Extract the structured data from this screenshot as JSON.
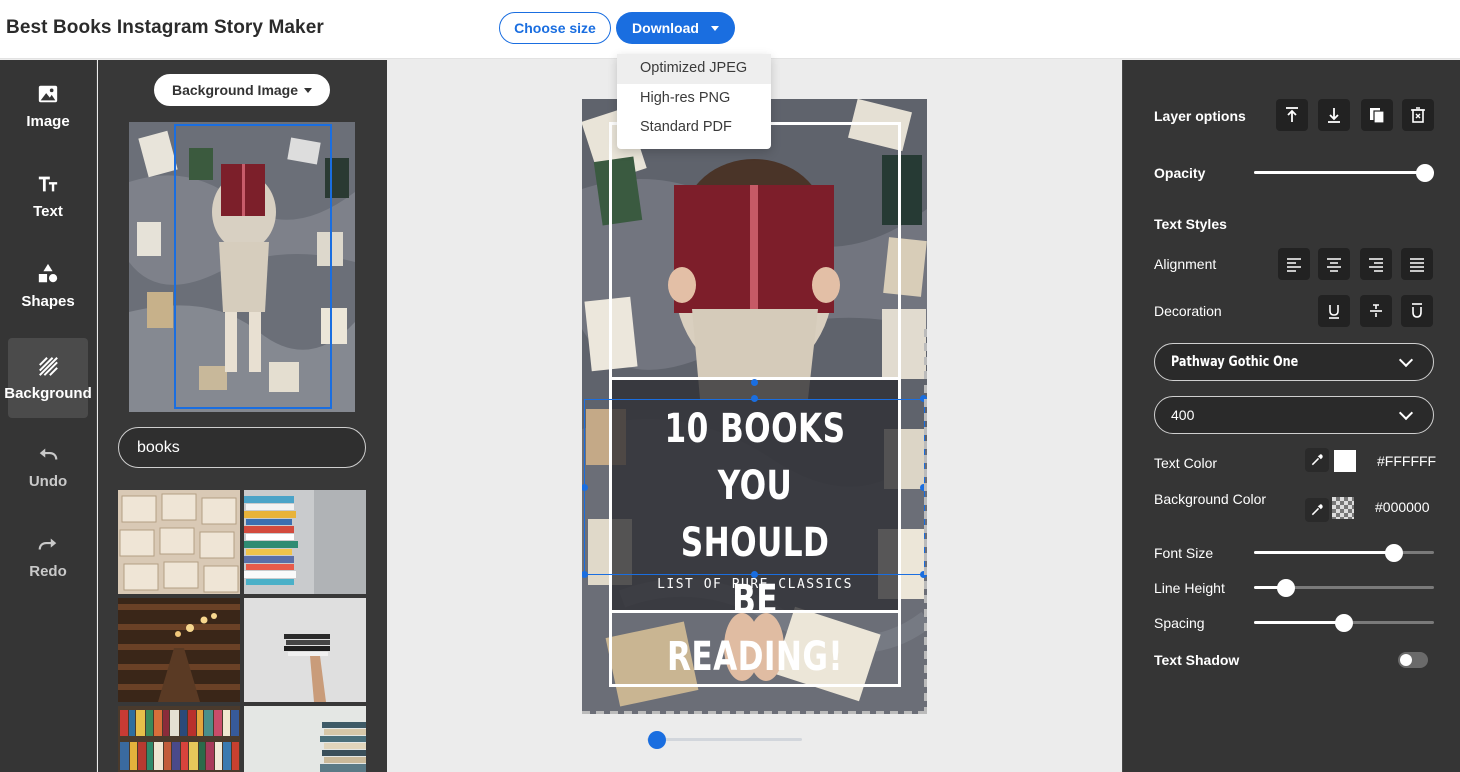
{
  "header": {
    "title": "Best Books Instagram Story Maker",
    "choose_size": "Choose size",
    "download": "Download"
  },
  "download_menu": {
    "items": [
      "Optimized JPEG",
      "High-res PNG",
      "Standard PDF"
    ],
    "highlighted": "Optimized JPEG"
  },
  "rail": {
    "items": [
      {
        "label": "Image",
        "icon": "image-icon"
      },
      {
        "label": "Text",
        "icon": "text-icon"
      },
      {
        "label": "Shapes",
        "icon": "shapes-icon"
      },
      {
        "label": "Background",
        "icon": "background-icon",
        "active": true
      },
      {
        "label": "Undo",
        "icon": "undo-icon"
      },
      {
        "label": "Redo",
        "icon": "redo-icon"
      }
    ]
  },
  "panel": {
    "select_label": "Background Image",
    "search_value": "books"
  },
  "story": {
    "headline_1": "10 BOOKS",
    "headline_2": "YOU SHOULD",
    "headline_3": "BE READING!",
    "subline": "LIST OF PURE CLASSICS"
  },
  "zoom": {
    "value": 0.02
  },
  "right_panel": {
    "layer_options": "Layer options",
    "opacity_label": "Opacity",
    "opacity": 1.0,
    "text_styles": "Text Styles",
    "alignment": "Alignment",
    "decoration": "Decoration",
    "font_family": "Pathway Gothic One",
    "font_weight": "400",
    "text_color_label": "Text Color",
    "text_color": "#FFFFFF",
    "bg_color_label": "Background Color",
    "bg_color": "#000000",
    "font_size_label": "Font Size",
    "font_size": 0.78,
    "line_height_label": "Line Height",
    "line_height": 0.18,
    "spacing_label": "Spacing",
    "spacing": 0.5,
    "text_shadow_label": "Text Shadow",
    "text_shadow": false
  },
  "colors": {
    "accent": "#1a6ee0",
    "panel": "#353535",
    "canvas": "#ececec"
  }
}
